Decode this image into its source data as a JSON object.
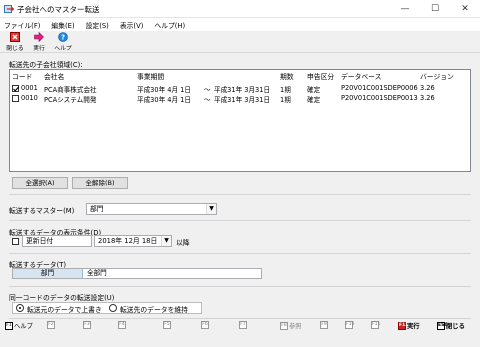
{
  "window": {
    "title": "子会社へのマスター転送",
    "min_glyph": "—",
    "max_glyph": "☐",
    "close_glyph": "✕"
  },
  "menu": [
    "ファイル(F)",
    "編集(E)",
    "設定(S)",
    "表示(V)",
    "ヘルプ(H)"
  ],
  "toolbar": {
    "close_label": "閉じる",
    "run_label": "実行",
    "help_label": "ヘルプ"
  },
  "target_label": "転送先の子会社領域(C):",
  "list": {
    "headers": [
      "コード",
      "会社名",
      "事業期間",
      "期数",
      "申告区分",
      "データベース",
      "バージョン"
    ],
    "rows": [
      {
        "code": "0001",
        "name": "PCA商事株式会社",
        "period_start": "平成30年 4月 1日",
        "tilde": "～",
        "period_end": "平成31年 3月31日",
        "term": "1期",
        "filing": "確定",
        "database": "P20V01C001SDEP0006",
        "version": "3.26",
        "checked": true
      },
      {
        "code": "0010",
        "name": "PCAシステム開発",
        "period_start": "平成30年 4月 1日",
        "tilde": "～",
        "period_end": "平成31年 3月31日",
        "term": "1期",
        "filing": "確定",
        "database": "P20V01C001SDEP0013",
        "version": "3.26",
        "checked": false
      }
    ]
  },
  "buttons": {
    "select_all": "全選択(A)",
    "deselect_all": "全解除(B)"
  },
  "master": {
    "label": "転送するマスター(M)",
    "value": "部門"
  },
  "condition": {
    "label": "転送するデータの表示条件(D)",
    "field_value": "更新日付",
    "date_value": "2018年 12月 18日",
    "suffix": "以降"
  },
  "data": {
    "label": "転送するデータ(T)",
    "col1": "部門",
    "col2": "全部門"
  },
  "same_code": {
    "label": "同一コードのデータの転送設定(U)",
    "option1": "転送元のデータで上書き",
    "option2": "転送先のデータを維持",
    "selected": 1
  },
  "fkeys": [
    {
      "key": "F1",
      "label": "ヘルプ",
      "state": "active"
    },
    {
      "key": "F2",
      "label": "",
      "state": "disabled"
    },
    {
      "key": "F3",
      "label": "",
      "state": "disabled"
    },
    {
      "key": "F4",
      "label": "",
      "state": "disabled"
    },
    {
      "key": "F5",
      "label": "",
      "state": "disabled"
    },
    {
      "key": "F6",
      "label": "",
      "state": "disabled"
    },
    {
      "key": "F7",
      "label": "",
      "state": "disabled"
    },
    {
      "key": "F8",
      "label": "参照",
      "state": "disabled"
    },
    {
      "key": "F9",
      "label": "",
      "state": "disabled"
    },
    {
      "key": "F10",
      "label": "",
      "state": "disabled"
    },
    {
      "key": "F11",
      "label": "",
      "state": "disabled"
    },
    {
      "key": "F12",
      "label": "実行",
      "state": "red"
    },
    {
      "key": "ESC",
      "label": "閉じる",
      "state": "active"
    }
  ]
}
